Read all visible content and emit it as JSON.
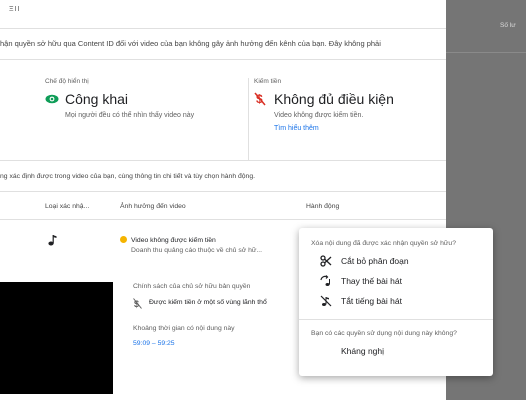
{
  "topbar": {
    "tiny_text": "ΞII"
  },
  "banner": {
    "text": "hận quyền sở hữu qua Content ID đối với video của bạn không gây ảnh hưởng đến kênh của bạn. Đây không phải"
  },
  "visibility": {
    "label": "Chế độ hiển thị",
    "value": "Công khai",
    "description": "Mọi người đều có thể nhìn thấy video này",
    "icon": "eye-icon",
    "icon_color": "#0f9d58"
  },
  "monetization": {
    "label": "Kiếm tiền",
    "value": "Không đủ điều kiện",
    "description": "Video không được kiếm tiền.",
    "link": "Tìm hiểu thêm",
    "icon": "dollar-off-icon",
    "icon_color": "#d93025"
  },
  "description_line": "ng xác định được trong video của bạn, cùng thông tin chi tiết và tùy chọn hành động.",
  "table": {
    "headers": [
      "Loại xác nhậ...",
      "Ảnh hưởng đến video",
      "Hành động"
    ],
    "row": {
      "type_icon": "music-note-icon",
      "status": "Video không được kiếm tiền",
      "status_sub": "Doanh thu quảng cáo thuộc về chủ sở hữ...",
      "status_color": "#f5b400"
    }
  },
  "details": {
    "policy_label": "Chính sách của chủ sở hữu bản quyền",
    "policy_value": "Được kiếm tiền ở một số vùng lãnh thổ",
    "time_label": "Khoảng thời gian có nội dung này",
    "time_value": "59:09 – 59:25"
  },
  "overlay": {
    "header": "Số lư"
  },
  "menu": {
    "section1_label": "Xóa nội dung đã được xác nhận quyền sở hữu?",
    "items": [
      {
        "label": "Cắt bỏ phân đoạn",
        "icon": "scissors-icon"
      },
      {
        "label": "Thay thế bài hát",
        "icon": "replace-song-icon"
      },
      {
        "label": "Tắt tiếng bài hát",
        "icon": "mute-song-icon"
      }
    ],
    "section2_label": "Bạn có các quyền sử dụng nội dung này không?",
    "appeal": "Kháng nghị"
  }
}
